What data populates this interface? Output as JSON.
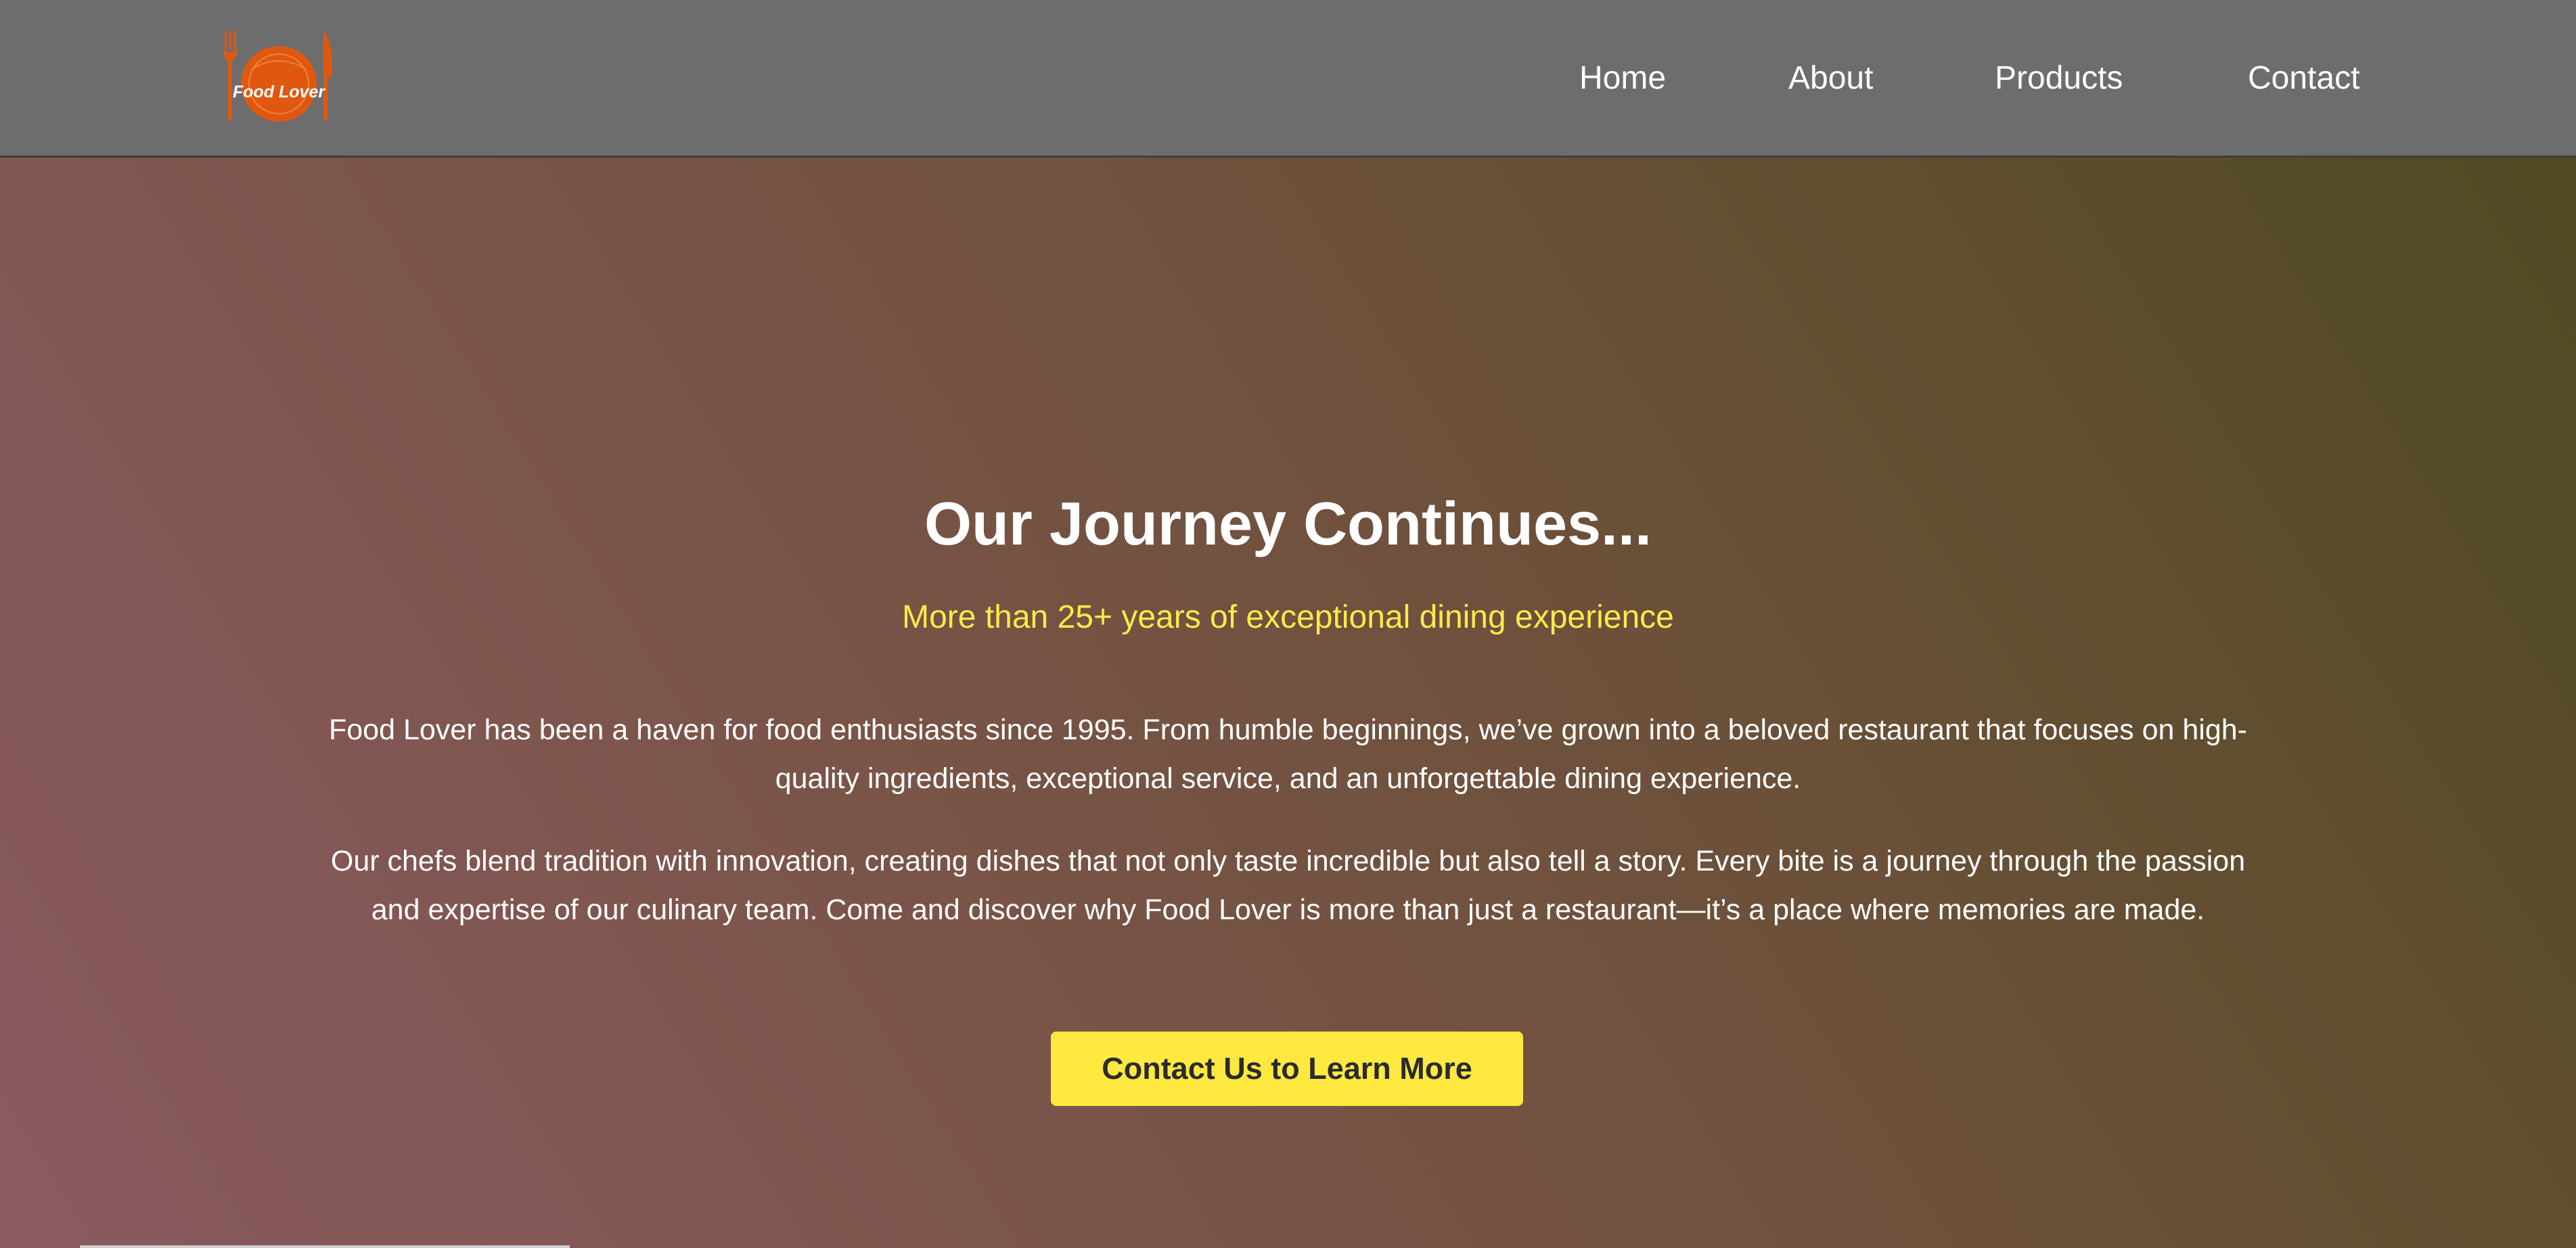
{
  "header": {
    "logo_text": "Food Lover",
    "nav": [
      {
        "label": "Home"
      },
      {
        "label": "About"
      },
      {
        "label": "Products"
      },
      {
        "label": "Contact"
      }
    ]
  },
  "hero": {
    "title": "Our Journey Continues...",
    "subtitle": "More than 25+ years of exceptional dining experience",
    "paragraphs": [
      "Food Lover has been a haven for food enthusiasts since 1995. From humble beginnings, we’ve grown into a beloved restaurant that focuses on high-quality ingredients, exceptional service, and an unforgettable dining experience.",
      "Our chefs blend tradition with innovation, creating dishes that not only taste incredible but also tell a story. Every bite is a journey through the passion and expertise of our culinary team. Come and discover why Food Lover is more than just a restaurant—it’s a place where memories are made."
    ],
    "cta_label": "Contact Us to Learn More"
  },
  "colors": {
    "navbar": "#6d6d6d",
    "subtitle": "#ffe94a",
    "cta_background": "#ffe940",
    "logo": "#e0580f"
  },
  "icons": {
    "logo": "fork-plate-knife-logo"
  }
}
